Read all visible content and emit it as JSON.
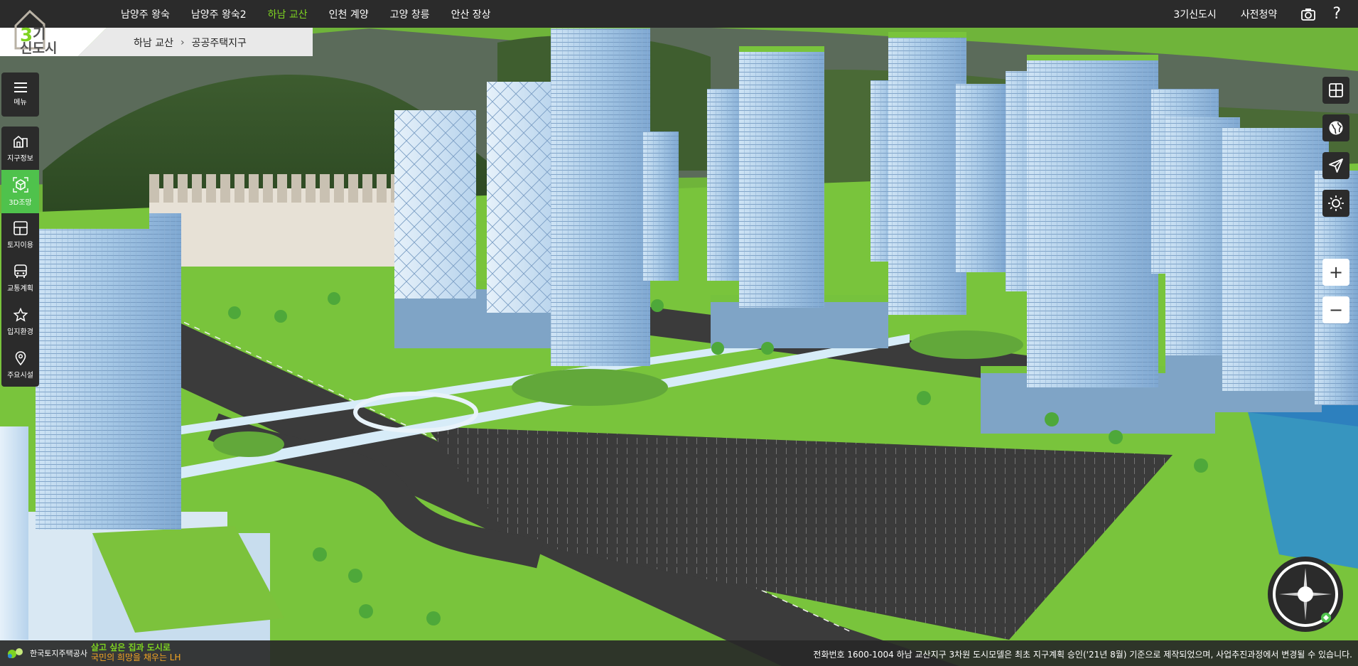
{
  "header": {
    "logo_text": "3기 신도시",
    "nav": [
      "남양주 왕숙",
      "남양주 왕숙2",
      "하남 교산",
      "인천 계양",
      "고양 창릉",
      "안산 장상"
    ],
    "active_nav": "하남 교산",
    "right_links": [
      "3기신도시",
      "사전청약"
    ],
    "right_icons": [
      "camera-icon",
      "help-icon"
    ],
    "help_glyph": "?"
  },
  "breadcrumb": {
    "city": "하남 교산",
    "separator": "›",
    "section": "공공주택지구"
  },
  "sidebar": {
    "menu": {
      "icon": "hamburger-icon",
      "label": "메뉴"
    },
    "items": [
      {
        "icon": "district-building-icon",
        "label": "지구정보",
        "active": false
      },
      {
        "icon": "cube-3d-icon",
        "label": "3D조망",
        "active": true
      },
      {
        "icon": "land-use-grid-icon",
        "label": "토지이용",
        "active": false
      },
      {
        "icon": "bus-icon",
        "label": "교통계획",
        "active": false
      },
      {
        "icon": "star-icon",
        "label": "입지환경",
        "active": false
      },
      {
        "icon": "map-pin-icon",
        "label": "주요시설",
        "active": false
      }
    ]
  },
  "right_tools": [
    "layers-grid-icon",
    "globe-icon",
    "navigate-arrow-icon",
    "sun-icon"
  ],
  "zoom": {
    "in": "+",
    "out": "−"
  },
  "footer": {
    "org_name": "한국토지주택공사",
    "slogan_line1": "살고 싶은 집과 도시로",
    "slogan_line2": "국민의 희망을 채우는 LH",
    "notice": "전화번호 1600-1004   하남 교산지구 3차원 도시모델은 최초 지구계획 승인('21년 8월) 기준으로 제작되었으며, 사업추진과정에서 변경될 수 있습니다."
  },
  "colors": {
    "active_green": "#7ed321",
    "sidebar_active": "#4fc24c",
    "bar_bg": "#2b2b2b",
    "slogan_orange": "#f5a623"
  }
}
